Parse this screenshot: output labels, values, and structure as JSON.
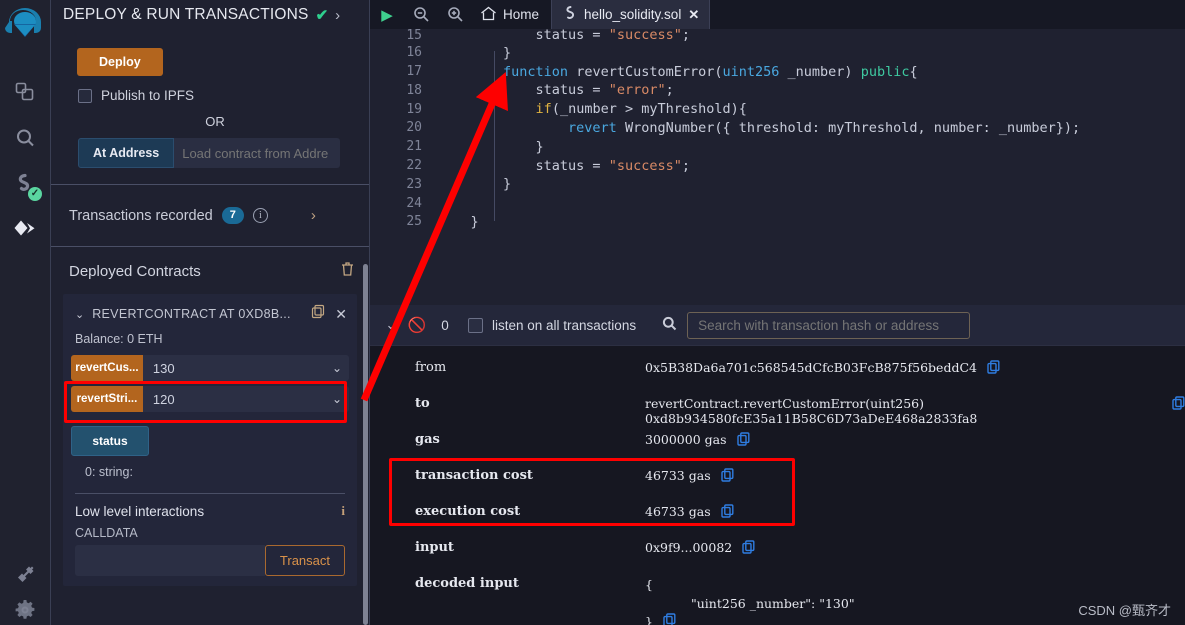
{
  "rail": {
    "items": [
      {
        "name": "remix-logo",
        "label": "Remix"
      },
      {
        "name": "file-explorer-icon",
        "label": "File explorer"
      },
      {
        "name": "search-icon",
        "label": "Search in files"
      },
      {
        "name": "solidity-compiler-icon",
        "label": "Solidity compiler"
      },
      {
        "name": "deploy-run-icon",
        "label": "Deploy & run transactions"
      },
      {
        "name": "plugin-icon",
        "label": "Plugin manager"
      },
      {
        "name": "settings-gear-icon",
        "label": "Settings"
      }
    ]
  },
  "panel": {
    "title": "DEPLOY & RUN TRANSACTIONS",
    "deploy_label": "Deploy",
    "publish_ipfs_label": "Publish to IPFS",
    "or_label": "OR",
    "at_address_label": "At Address",
    "at_address_placeholder": "Load contract from Addre",
    "transactions_recorded_label": "Transactions recorded",
    "transactions_recorded_count": "7",
    "deployed_contracts_label": "Deployed Contracts",
    "contract": {
      "name": "REVERTCONTRACT AT 0XD8B...",
      "balance": "Balance: 0 ETH",
      "functions": [
        {
          "button": "revertCus...",
          "value": "130"
        },
        {
          "button": "revertStri...",
          "value": "120"
        }
      ],
      "getter": "status",
      "return_value": "0: string:"
    },
    "low_level_label": "Low level interactions",
    "calldata_label": "CALLDATA",
    "transact_label": "Transact"
  },
  "tabbar": {
    "run_label": "run",
    "zoom_out_label": "zoom out",
    "zoom_in_label": "zoom in",
    "home_label": "Home",
    "file_tab": "hello_solidity.sol"
  },
  "editor": {
    "lines": [
      {
        "n": "15",
        "tokens": [
          {
            "t": "            status = ",
            "c": "plain"
          },
          {
            "t": "\"success\"",
            "c": "str"
          },
          {
            "t": ";",
            "c": "plain"
          }
        ]
      },
      {
        "n": "16",
        "tokens": [
          {
            "t": "        }",
            "c": "plain"
          }
        ]
      },
      {
        "n": "17",
        "tokens": [
          {
            "t": "        ",
            "c": "plain"
          },
          {
            "t": "function",
            "c": "kw"
          },
          {
            "t": " revertCustomError(",
            "c": "plain"
          },
          {
            "t": "uint256",
            "c": "type"
          },
          {
            "t": " _number) ",
            "c": "plain"
          },
          {
            "t": "public",
            "c": "pub"
          },
          {
            "t": "{",
            "c": "plain"
          }
        ]
      },
      {
        "n": "18",
        "tokens": [
          {
            "t": "            status = ",
            "c": "plain"
          },
          {
            "t": "\"error\"",
            "c": "str"
          },
          {
            "t": ";",
            "c": "plain"
          }
        ]
      },
      {
        "n": "19",
        "tokens": [
          {
            "t": "            ",
            "c": "plain"
          },
          {
            "t": "if",
            "c": "if"
          },
          {
            "t": "(_number > myThreshold){",
            "c": "plain"
          }
        ]
      },
      {
        "n": "20",
        "tokens": [
          {
            "t": "                ",
            "c": "plain"
          },
          {
            "t": "revert",
            "c": "kw"
          },
          {
            "t": " WrongNumber({ threshold: myThreshold, number: _number});",
            "c": "plain"
          }
        ]
      },
      {
        "n": "21",
        "tokens": [
          {
            "t": "            }",
            "c": "plain"
          }
        ]
      },
      {
        "n": "22",
        "tokens": [
          {
            "t": "            status = ",
            "c": "plain"
          },
          {
            "t": "\"success\"",
            "c": "str"
          },
          {
            "t": ";",
            "c": "plain"
          }
        ]
      },
      {
        "n": "23",
        "tokens": [
          {
            "t": "        }",
            "c": "plain"
          }
        ]
      },
      {
        "n": "24",
        "tokens": [
          {
            "t": "",
            "c": "plain"
          }
        ]
      },
      {
        "n": "25",
        "tokens": [
          {
            "t": "    }",
            "c": "plain"
          }
        ]
      }
    ]
  },
  "terminal": {
    "toolbar": {
      "count": "0",
      "listen_label": "listen on all transactions",
      "search_placeholder": "Search with transaction hash or address"
    },
    "rows": [
      {
        "key": "from",
        "bold": false,
        "value": "0x5B38Da6a701c568545dCfcB03FcB875f56beddC4",
        "copy": true
      },
      {
        "key": "to",
        "bold": true,
        "value": "revertContract.revertCustomError(uint256) 0xd8b934580fcE35a11B58C6D73aDeE468a2833fa8",
        "copy": true
      },
      {
        "key": "gas",
        "bold": true,
        "value": "3000000 gas",
        "copy": true
      },
      {
        "key": "transaction cost",
        "bold": true,
        "value": "46733 gas",
        "copy": true
      },
      {
        "key": "execution cost",
        "bold": true,
        "value": "46733 gas",
        "copy": true
      },
      {
        "key": "input",
        "bold": true,
        "value": "0x9f9...00082",
        "copy": true
      }
    ],
    "decoded_input": {
      "key": "decoded input",
      "open": "{",
      "entry": "\"uint256 _number\": \"130\"",
      "close": "}"
    }
  },
  "watermark": "CSDN @甄齐才",
  "colors": {
    "accent_orange": "#b3651e",
    "accent_blue": "#23516e",
    "annotation_red": "#fe0000",
    "badge_blue": "#1a6a96",
    "success_green": "#2ecf8e"
  }
}
